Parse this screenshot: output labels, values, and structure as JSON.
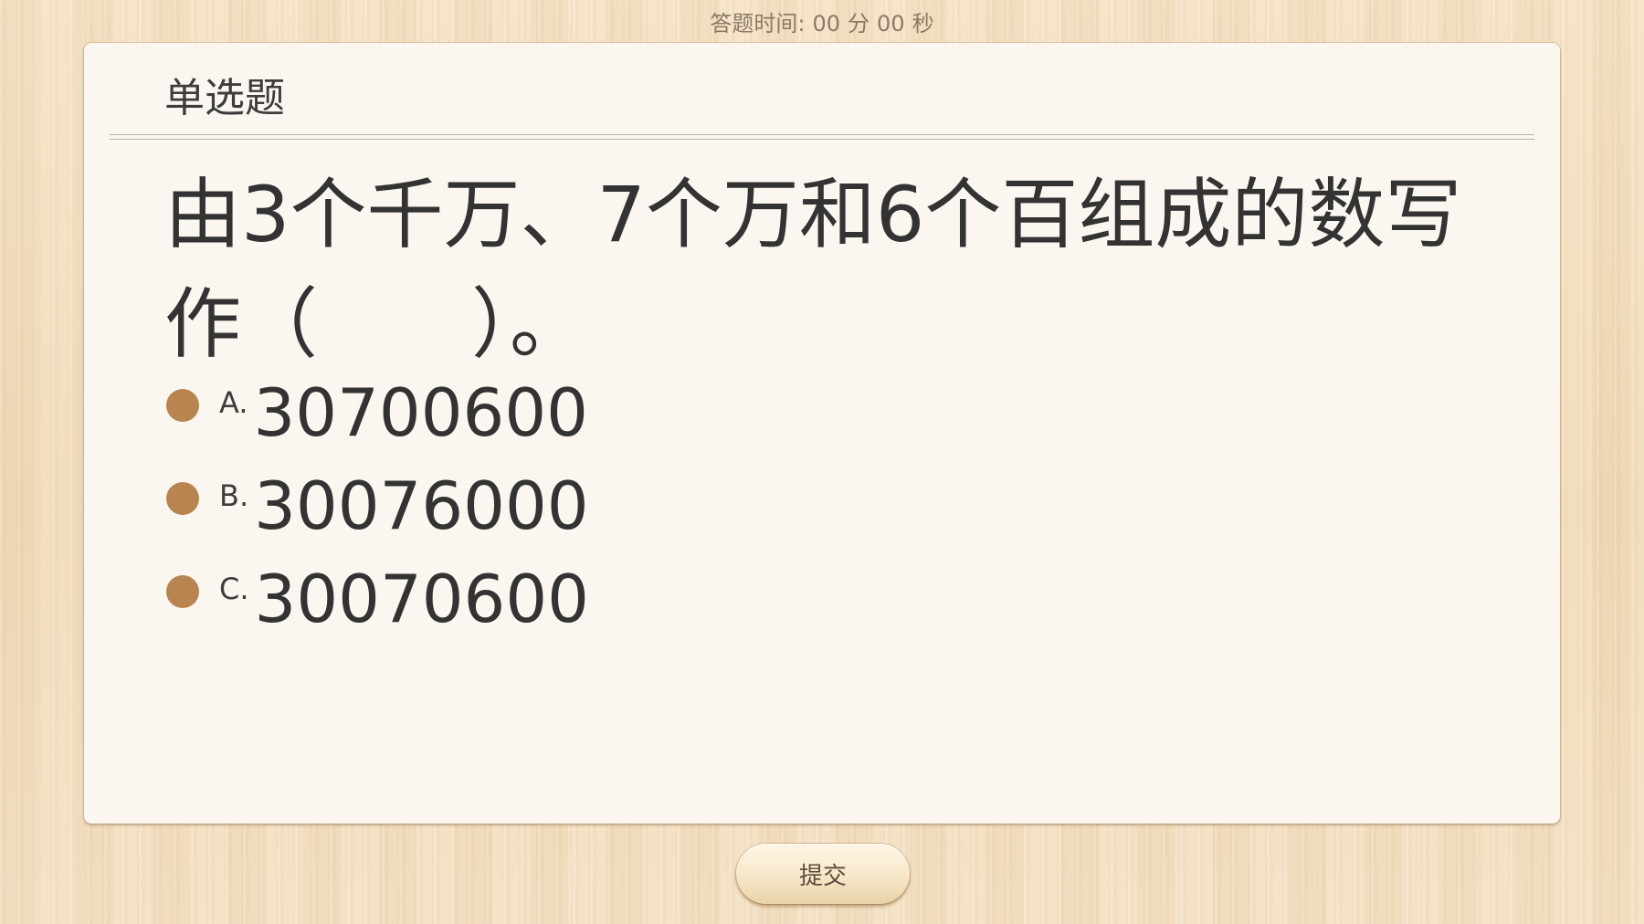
{
  "header": {
    "timer_label": "答题时间:",
    "minutes": "00",
    "minutes_unit": "分",
    "seconds": "00",
    "seconds_unit": "秒"
  },
  "question": {
    "type_label": "单选题",
    "text": "由3个千万、7个万和6个百组成的数写作（　　）。",
    "options": [
      {
        "letter": "A.",
        "text": "30700600"
      },
      {
        "letter": "B.",
        "text": "30076000"
      },
      {
        "letter": "C.",
        "text": "30070600"
      }
    ]
  },
  "footer": {
    "submit_label": "提交"
  },
  "colors": {
    "bullet": "#b8844f",
    "card": "#fbf7f0",
    "background": "#f3dfc0"
  }
}
